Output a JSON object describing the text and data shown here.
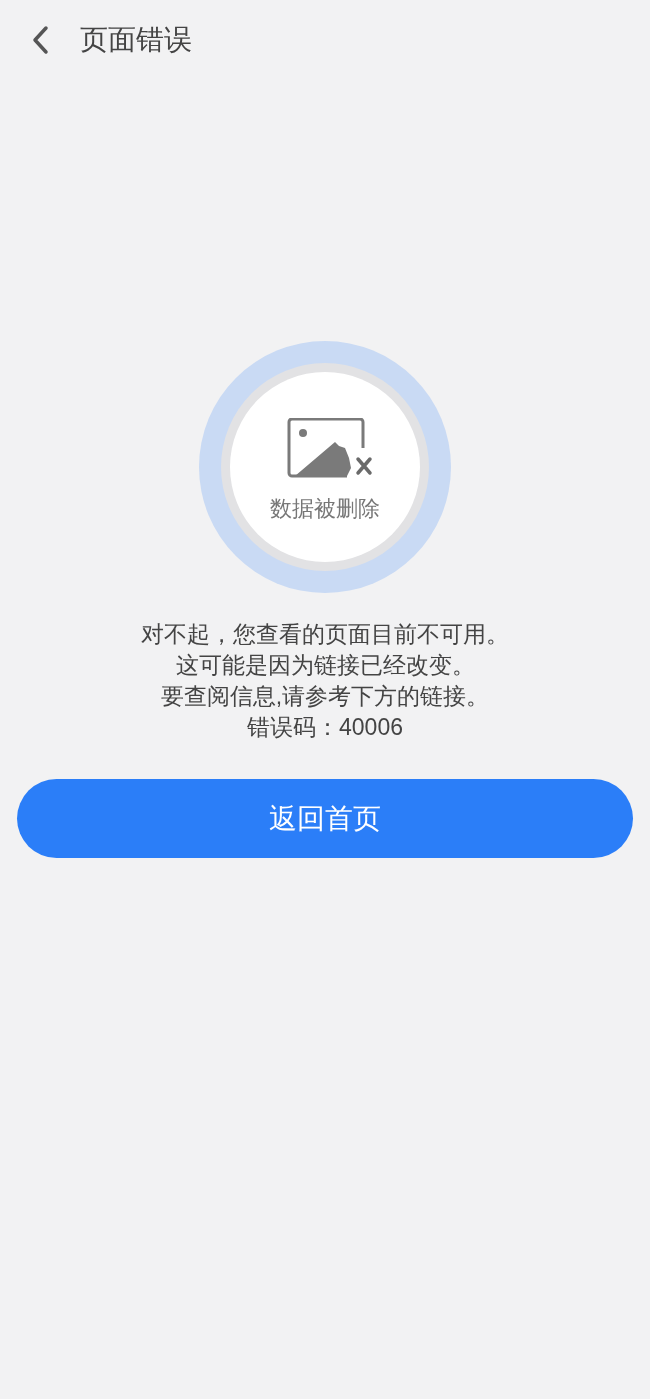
{
  "header": {
    "title": "页面错误"
  },
  "status": {
    "label": "数据被删除"
  },
  "message_lines": [
    "对不起，您查看的页面目前不可用。",
    "这可能是因为链接已经改变。",
    "要查阅信息,请参考下方的链接。",
    "错误码：40006"
  ],
  "button": {
    "label": "返回首页"
  }
}
